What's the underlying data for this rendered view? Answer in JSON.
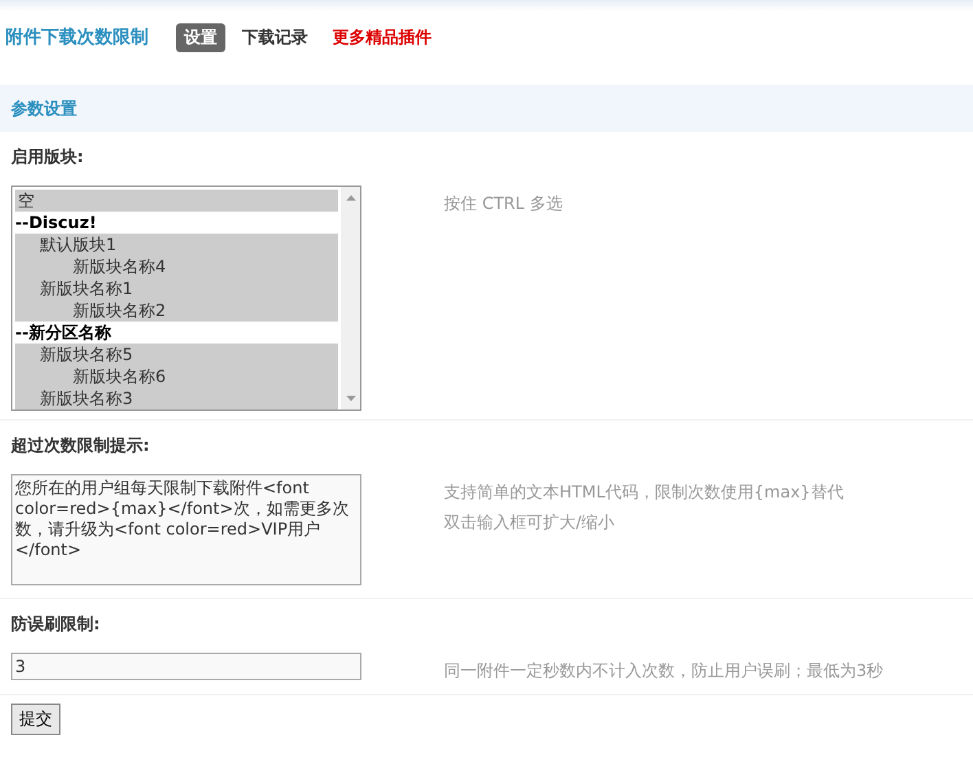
{
  "header": {
    "title": "附件下载次数限制",
    "tabs": [
      {
        "label": "设置",
        "selected": true,
        "kind": "tab"
      },
      {
        "label": "下载记录",
        "selected": false,
        "kind": "tab"
      },
      {
        "label": "更多精品插件",
        "kind": "promo"
      }
    ]
  },
  "section": {
    "title": "参数设置"
  },
  "settings": [
    {
      "kind": "listbox",
      "label": "启用版块:",
      "hint": [
        "按住 CTRL 多选"
      ],
      "options": [
        {
          "kind": "option",
          "label": "空",
          "selected": true
        },
        {
          "kind": "group",
          "label": "--Discuz!",
          "children": [
            {
              "kind": "option",
              "label": "默认版块1",
              "selected": true,
              "children": [
                {
                  "kind": "option",
                  "label": "新版块名称4",
                  "selected": true
                }
              ]
            },
            {
              "kind": "option",
              "label": "新版块名称1",
              "selected": true,
              "children": [
                {
                  "kind": "option",
                  "label": "新版块名称2",
                  "selected": true
                }
              ]
            }
          ]
        },
        {
          "kind": "group",
          "label": "--新分区名称",
          "children": [
            {
              "kind": "option",
              "label": "新版块名称5",
              "selected": true,
              "children": [
                {
                  "kind": "option",
                  "label": "新版块名称6",
                  "selected": true
                }
              ]
            },
            {
              "kind": "option",
              "label": "新版块名称3",
              "selected": true
            }
          ]
        }
      ]
    },
    {
      "kind": "textarea",
      "label": "超过次数限制提示:",
      "value": "您所在的用户组每天限制下载附件<font color=red>{max}</font>次，如需更多次数，请升级为<font color=red>VIP用户</font>",
      "hint": [
        "支持简单的文本HTML代码，限制次数使用{max}替代",
        "双击输入框可扩大/缩小"
      ]
    },
    {
      "kind": "input",
      "label": "防误刷限制:",
      "value": "3",
      "hint": [
        "同一附件一定秒数内不计入次数，防止用户误刷；最低为3秒"
      ]
    }
  ],
  "submit": {
    "label": "提交"
  }
}
